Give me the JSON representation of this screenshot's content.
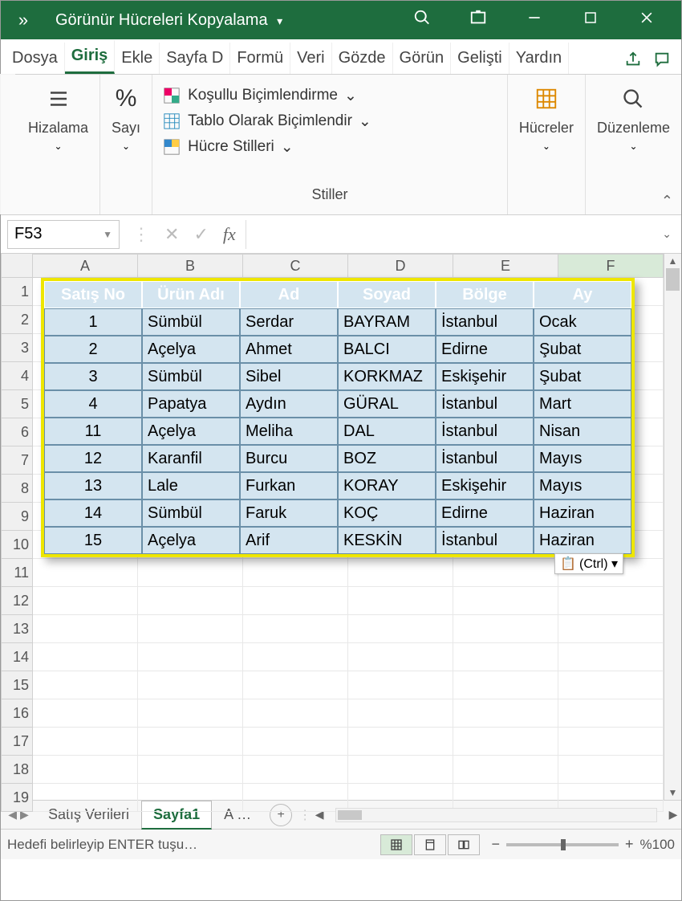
{
  "titlebar": {
    "arrows": "»",
    "title": "Görünür Hücreleri Kopyalama",
    "dropdown": "▾"
  },
  "tabs": [
    "Dosya",
    "Giriş",
    "Ekle",
    "Sayfa D",
    "Formü",
    "Veri",
    "Gözde",
    "Görün",
    "Gelişti",
    "Yardın"
  ],
  "active_tab": 1,
  "ribbon": {
    "g1": {
      "label": "Hizalama"
    },
    "g2": {
      "icon": "%",
      "label": "Sayı"
    },
    "styles": {
      "row1": "Koşullu Biçimlendirme",
      "row2": "Tablo Olarak Biçimlendir",
      "row3": "Hücre Stilleri",
      "label": "Stiller"
    },
    "g4": {
      "label": "Hücreler"
    },
    "g5": {
      "label": "Düzenleme"
    }
  },
  "namebox": "F53",
  "fx": "fx",
  "columns": [
    "A",
    "B",
    "C",
    "D",
    "E",
    "F"
  ],
  "rownums": [
    1,
    2,
    3,
    4,
    5,
    6,
    7,
    8,
    9,
    10,
    11,
    12,
    13,
    14,
    15,
    16,
    17,
    18,
    19
  ],
  "table": {
    "headers": [
      "Satış No",
      "Ürün Adı",
      "Ad",
      "Soyad",
      "Bölge",
      "Ay"
    ],
    "rows": [
      [
        "1",
        "Sümbül",
        "Serdar",
        "BAYRAM",
        "İstanbul",
        "Ocak"
      ],
      [
        "2",
        "Açelya",
        "Ahmet",
        "BALCI",
        "Edirne",
        "Şubat"
      ],
      [
        "3",
        "Sümbül",
        "Sibel",
        "KORKMAZ",
        "Eskişehir",
        "Şubat"
      ],
      [
        "4",
        "Papatya",
        "Aydın",
        "GÜRAL",
        "İstanbul",
        "Mart"
      ],
      [
        "11",
        "Açelya",
        "Meliha",
        "DAL",
        "İstanbul",
        "Nisan"
      ],
      [
        "12",
        "Karanfil",
        "Burcu",
        "BOZ",
        "İstanbul",
        "Mayıs"
      ],
      [
        "13",
        "Lale",
        "Furkan",
        "KORAY",
        "Eskişehir",
        "Mayıs"
      ],
      [
        "14",
        "Sümbül",
        "Faruk",
        "KOÇ",
        "Edirne",
        "Haziran"
      ],
      [
        "15",
        "Açelya",
        "Arif",
        "KESKİN",
        "İstanbul",
        "Haziran"
      ]
    ]
  },
  "paste_tag": "(Ctrl) ▾",
  "sheets": {
    "list": [
      "Satış Verileri",
      "Sayfa1",
      "A  …"
    ],
    "active": 1
  },
  "status": {
    "msg": "Hedefi belirleyip ENTER tuşu…",
    "zoom": "%100"
  }
}
